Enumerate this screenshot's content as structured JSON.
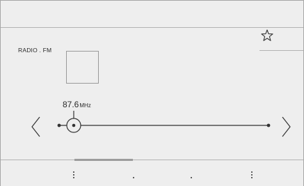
{
  "source": {
    "label": "RADIO . FM"
  },
  "tuner": {
    "frequency": "87.6",
    "unit": "MHz",
    "band_min": "87.5",
    "band_max": "108.0"
  },
  "icons": {
    "favorite": "star-outline-icon",
    "previous": "chevron-left-icon",
    "next": "chevron-right-icon",
    "more": "vertical-ellipsis-icon"
  },
  "colors": {
    "background": "#eeeeee",
    "line": "#333333",
    "divider": "#b3b3b3",
    "page_indicator": "#9c9c9c"
  },
  "bottom_nav": {
    "page_count": 2,
    "active_page": 1
  }
}
